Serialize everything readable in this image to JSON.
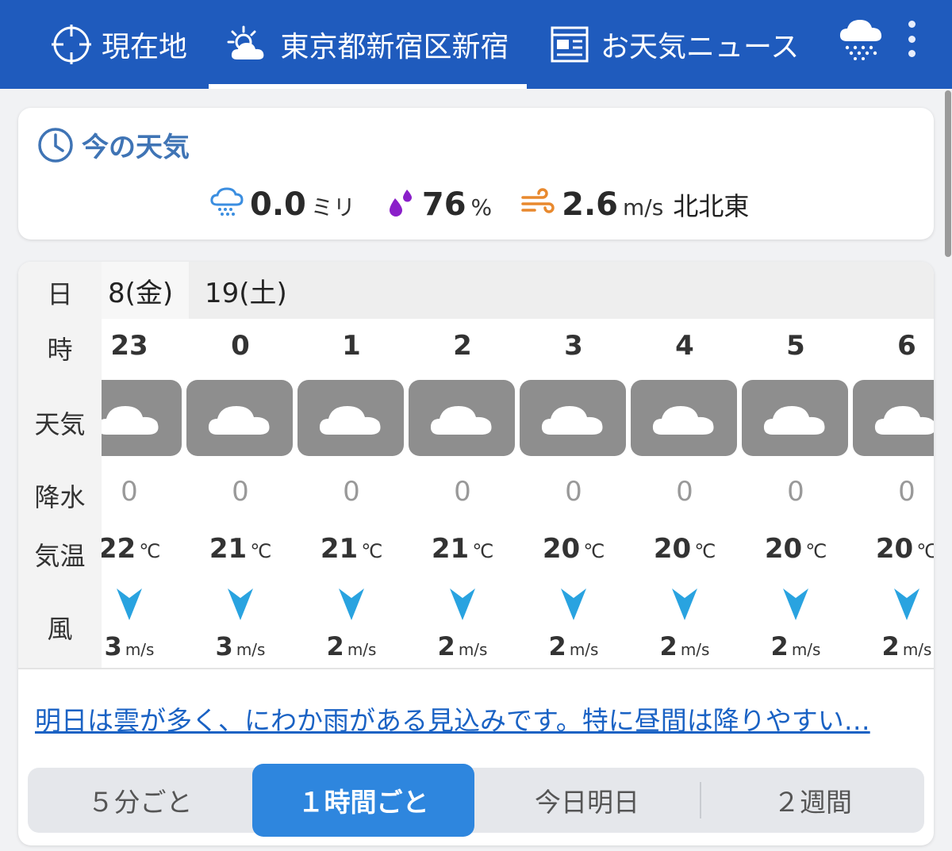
{
  "topbar": {
    "tabs": [
      {
        "label": "現在地",
        "icon": "crosshair-icon"
      },
      {
        "label": "東京都新宿区新宿",
        "icon": "sun-cloud-icon",
        "active": true
      },
      {
        "label": "お天気ニュース",
        "icon": "newspaper-icon"
      }
    ],
    "rain_icon": "rain-cloud-icon",
    "more_icon": "more-vert-icon"
  },
  "now": {
    "title": "今の天気",
    "precip": {
      "value": "0.0",
      "unit": "ミリ"
    },
    "humidity": {
      "value": "76",
      "unit": "%"
    },
    "wind": {
      "value": "2.6",
      "unit": "m/s",
      "direction": "北北東"
    }
  },
  "hourly": {
    "labels": {
      "day": "日",
      "hour": "時",
      "weather": "天気",
      "precip": "降水",
      "temp": "気温",
      "wind": "風"
    },
    "days": [
      "8(金)",
      "19(土)"
    ],
    "temp_unit": "℃",
    "wind_unit": "m/s",
    "hours": [
      {
        "hour": "23",
        "precip": "0",
        "temp": "22",
        "wind": "3"
      },
      {
        "hour": "0",
        "precip": "0",
        "temp": "21",
        "wind": "3"
      },
      {
        "hour": "1",
        "precip": "0",
        "temp": "21",
        "wind": "2"
      },
      {
        "hour": "2",
        "precip": "0",
        "temp": "21",
        "wind": "2"
      },
      {
        "hour": "3",
        "precip": "0",
        "temp": "20",
        "wind": "2"
      },
      {
        "hour": "4",
        "precip": "0",
        "temp": "20",
        "wind": "2"
      },
      {
        "hour": "5",
        "precip": "0",
        "temp": "20",
        "wind": "2"
      },
      {
        "hour": "6",
        "precip": "0",
        "temp": "20",
        "wind": "2"
      }
    ],
    "forecast_text": "明日は雲が多く、にわか雨がある見込みです。特に昼間は降りやすい…"
  },
  "segments": {
    "items": [
      "５分ごと",
      "１時間ごと",
      "今日明日",
      "２週間"
    ],
    "active": 1
  },
  "colors": {
    "accent": "#1f5bbd",
    "active_segment": "#2e86de",
    "wind_arrow": "#29a3e0",
    "link": "#1a62c4"
  }
}
